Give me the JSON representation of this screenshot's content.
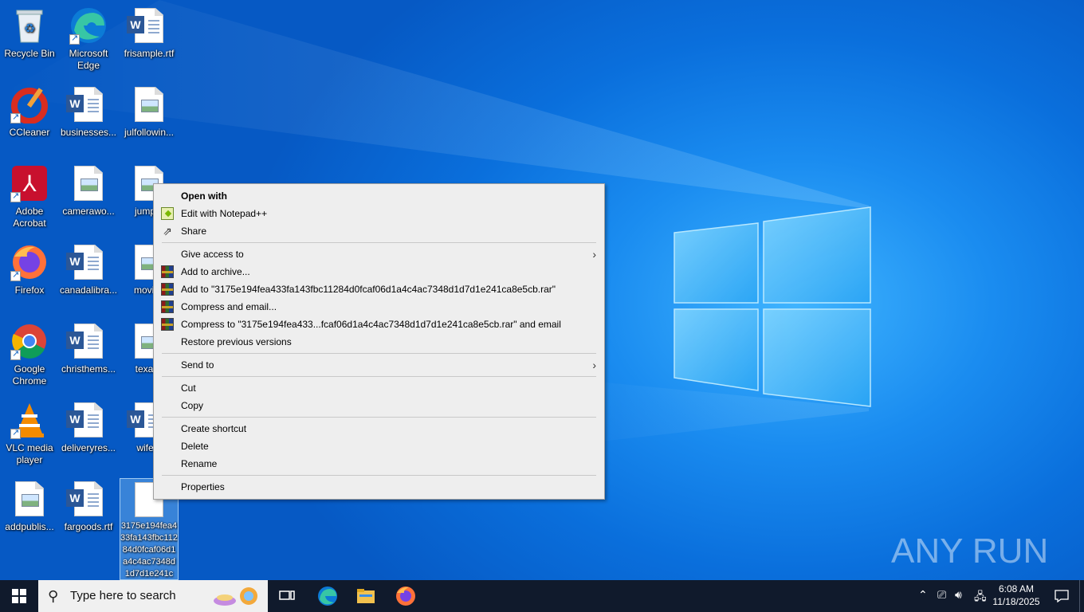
{
  "desktop": {
    "icons": [
      {
        "label": "Recycle Bin",
        "icon": "recycle-bin-icon"
      },
      {
        "label": "Microsoft Edge",
        "icon": "edge-icon"
      },
      {
        "label": "frisample.rtf",
        "icon": "word-doc-icon"
      },
      {
        "label": "CCleaner",
        "icon": "ccleaner-icon"
      },
      {
        "label": "businesses...",
        "icon": "word-doc-icon"
      },
      {
        "label": "julfollowin...",
        "icon": "image-file-icon"
      },
      {
        "label": "Adobe Acrobat",
        "icon": "acrobat-icon"
      },
      {
        "label": "camerawo...",
        "icon": "image-file-icon"
      },
      {
        "label": "jumpth",
        "icon": "image-file-icon"
      },
      {
        "label": "Firefox",
        "icon": "firefox-icon"
      },
      {
        "label": "canadalibra...",
        "icon": "word-doc-icon"
      },
      {
        "label": "movies",
        "icon": "image-file-icon"
      },
      {
        "label": "Google Chrome",
        "icon": "chrome-icon"
      },
      {
        "label": "christhems...",
        "icon": "word-doc-icon"
      },
      {
        "label": "texass",
        "icon": "image-file-icon"
      },
      {
        "label": "VLC media player",
        "icon": "vlc-icon"
      },
      {
        "label": "deliveryres...",
        "icon": "word-doc-icon"
      },
      {
        "label": "wifeto",
        "icon": "word-doc-icon"
      },
      {
        "label": "addpublis...",
        "icon": "image-file-icon"
      },
      {
        "label": "fargoods.rtf",
        "icon": "word-doc-icon"
      },
      {
        "label": "3175e194fea433fa143fbc11284d0fcaf06d1a4c4ac7348d1d7d1e241c",
        "icon": "blank-file-icon"
      }
    ]
  },
  "context_menu": {
    "items": [
      {
        "label": "Open with",
        "bold": true
      },
      {
        "label": "Edit with Notepad++",
        "icon": "notepad-plus-plus-icon"
      },
      {
        "label": "Share",
        "icon": "share-icon"
      },
      {
        "label": "Give access to",
        "submenu": true
      },
      {
        "label": "Add to archive...",
        "icon": "winrar-icon"
      },
      {
        "label": "Add to \"3175e194fea433fa143fbc11284d0fcaf06d1a4c4ac7348d1d7d1e241ca8e5cb.rar\"",
        "icon": "winrar-icon"
      },
      {
        "label": "Compress and email...",
        "icon": "winrar-icon"
      },
      {
        "label": "Compress to \"3175e194fea433...fcaf06d1a4c4ac7348d1d7d1e241ca8e5cb.rar\" and email",
        "icon": "winrar-icon"
      },
      {
        "label": "Restore previous versions"
      },
      {
        "label": "Send to",
        "submenu": true
      },
      {
        "label": "Cut"
      },
      {
        "label": "Copy"
      },
      {
        "label": "Create shortcut"
      },
      {
        "label": "Delete"
      },
      {
        "label": "Rename"
      },
      {
        "label": "Properties"
      }
    ]
  },
  "taskbar": {
    "search_placeholder": "Type here to search",
    "time": "6:08 AM",
    "date": "11/18/2025",
    "pinned": [
      "task-view-icon",
      "edge-icon",
      "file-explorer-icon",
      "firefox-icon"
    ]
  },
  "watermark": {
    "text": "ANY RUN"
  },
  "colors": {
    "desktop_blue": "#0a6fdc",
    "taskbar": "#101a2c",
    "menu_bg": "#eeeeee"
  }
}
